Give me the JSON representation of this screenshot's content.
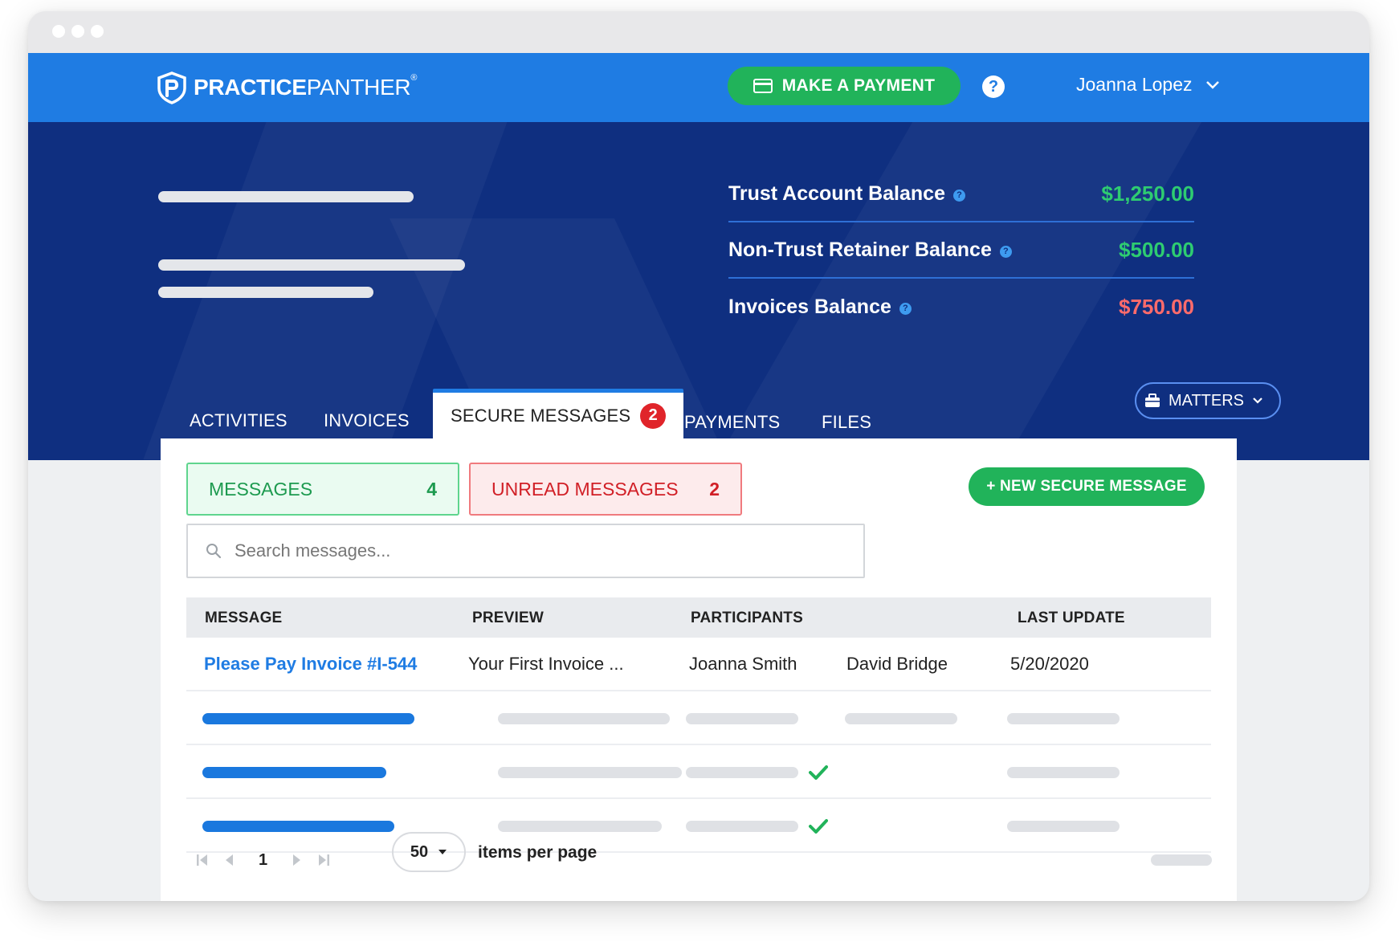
{
  "brand": {
    "name_bold": "PRACTICE",
    "name_light": "PANTHER",
    "reg": "®"
  },
  "header": {
    "pay_label": "MAKE A PAYMENT",
    "help_glyph": "?",
    "user_name": "Joanna Lopez"
  },
  "balances": [
    {
      "label": "Trust Account Balance",
      "value": "$1,250.00",
      "color": "#2ecc71"
    },
    {
      "label": "Non-Trust Retainer Balance",
      "value": "$500.00",
      "color": "#2ecc71"
    },
    {
      "label": "Invoices Balance",
      "value": "$750.00",
      "color": "#ff6b6b"
    }
  ],
  "tabs": {
    "activities": "ACTIVITIES",
    "invoices": "INVOICES",
    "secure_messages": "SECURE MESSAGES",
    "secure_messages_badge": "2",
    "payments": "PAYMENTS",
    "files": "FILES",
    "matters": "MATTERS"
  },
  "stats": {
    "messages_label": "MESSAGES",
    "messages_count": "4",
    "unread_label": "UNREAD MESSAGES",
    "unread_count": "2"
  },
  "new_message_label": "+ NEW SECURE MESSAGE",
  "search": {
    "placeholder": "Search messages..."
  },
  "table": {
    "headers": {
      "message": "MESSAGE",
      "preview": "PREVIEW",
      "participants": "PARTICIPANTS",
      "last_update": "LAST UPDATE"
    },
    "first_row": {
      "message": "Please Pay Invoice #I-544",
      "preview": "Your First Invoice ...",
      "participant_1": "Joanna Smith",
      "participant_2": "David Bridge",
      "last_update": "5/20/2020"
    }
  },
  "pagination": {
    "page": "1",
    "per_page": "50",
    "per_page_label": "items per page"
  },
  "colors": {
    "primary": "#1f7ce3",
    "hero": "#0f2f80",
    "success": "#21b35a",
    "danger": "#e0242a"
  }
}
